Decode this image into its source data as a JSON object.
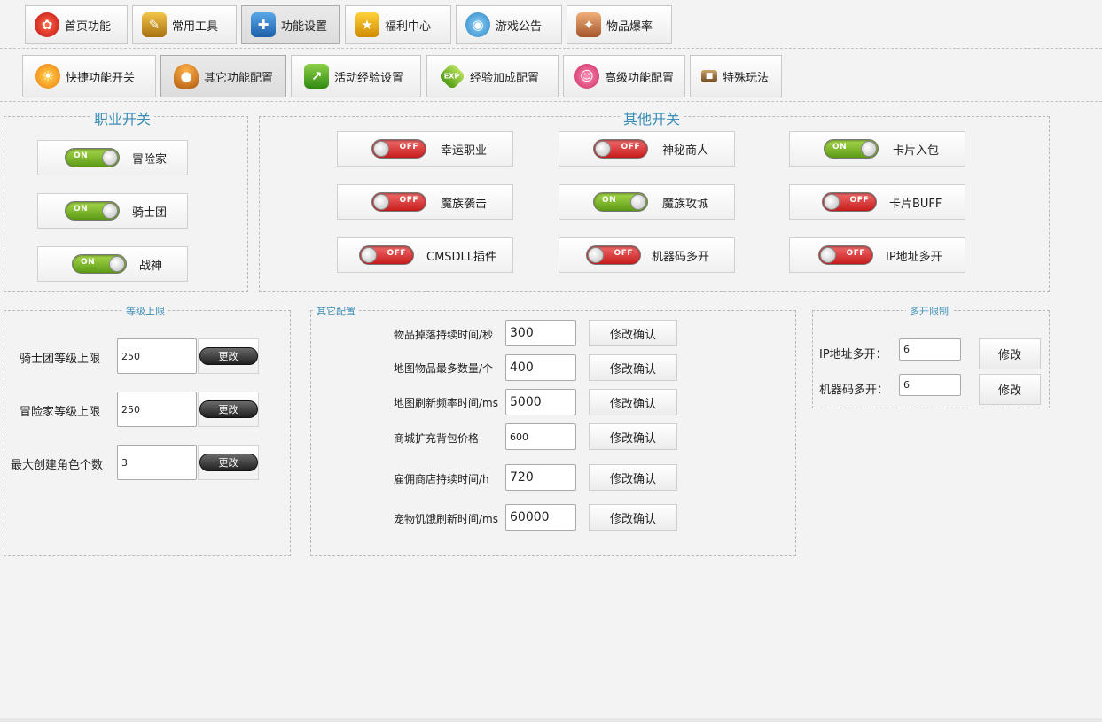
{
  "top_tabs": [
    {
      "label": "首页功能",
      "icon": "home-icon"
    },
    {
      "label": "常用工具",
      "icon": "tools-icon"
    },
    {
      "label": "功能设置",
      "icon": "settings-icon"
    },
    {
      "label": "福利中心",
      "icon": "gift-icon"
    },
    {
      "label": "游戏公告",
      "icon": "announcement-icon"
    },
    {
      "label": "物品爆率",
      "icon": "item-drop-icon"
    }
  ],
  "sub_tabs": [
    {
      "label": "快捷功能开关",
      "icon": "quick-switch-icon"
    },
    {
      "label": "其它功能配置",
      "icon": "mushroom-icon"
    },
    {
      "label": "活动经验设置",
      "icon": "activity-exp-icon"
    },
    {
      "label": "经验加成配置",
      "icon": "exp-bonus-icon"
    },
    {
      "label": "高级功能配置",
      "icon": "advanced-icon"
    },
    {
      "label": "特殊玩法",
      "icon": "special-play-icon"
    }
  ],
  "job_switch": {
    "title": "职业开关",
    "items": [
      {
        "label": "冒险家",
        "state": "ON"
      },
      {
        "label": "骑士团",
        "state": "ON"
      },
      {
        "label": "战神",
        "state": "ON"
      }
    ]
  },
  "other_switch": {
    "title": "其他开关",
    "items": [
      {
        "label": "幸运职业",
        "state": "OFF"
      },
      {
        "label": "神秘商人",
        "state": "OFF"
      },
      {
        "label": "卡片入包",
        "state": "ON"
      },
      {
        "label": "魔族袭击",
        "state": "OFF"
      },
      {
        "label": "魔族攻城",
        "state": "ON"
      },
      {
        "label": "卡片BUFF",
        "state": "OFF"
      },
      {
        "label": "CMSDLL插件",
        "state": "OFF"
      },
      {
        "label": "机器码多开",
        "state": "OFF"
      },
      {
        "label": "IP地址多开",
        "state": "OFF"
      }
    ]
  },
  "level_limit": {
    "title": "等级上限",
    "rows": [
      {
        "label": "骑士团等级上限",
        "value": "250",
        "button": "更改"
      },
      {
        "label": "冒险家等级上限",
        "value": "250",
        "button": "更改"
      },
      {
        "label": "最大创建角色个数",
        "value": "3",
        "button": "更改"
      }
    ]
  },
  "other_config": {
    "title": "其它配置",
    "rows": [
      {
        "label": "物品掉落持续时间/秒",
        "value": "300",
        "button": "修改确认"
      },
      {
        "label": "地图物品最多数量/个",
        "value": "400",
        "button": "修改确认"
      },
      {
        "label": "地图刷新频率时间/ms",
        "value": "5000",
        "button": "修改确认"
      },
      {
        "label": "商城扩充背包价格",
        "value": "600",
        "button": "修改确认"
      },
      {
        "label": "雇佣商店持续时间/h",
        "value": "720",
        "button": "修改确认"
      },
      {
        "label": "宠物饥饿刷新时间/ms",
        "value": "60000",
        "button": "修改确认"
      }
    ]
  },
  "multi_open": {
    "title": "多开限制",
    "rows": [
      {
        "label": "IP地址多开：",
        "value": "6",
        "button": "修改"
      },
      {
        "label": "机器码多开：",
        "value": "6",
        "button": "修改"
      }
    ]
  }
}
